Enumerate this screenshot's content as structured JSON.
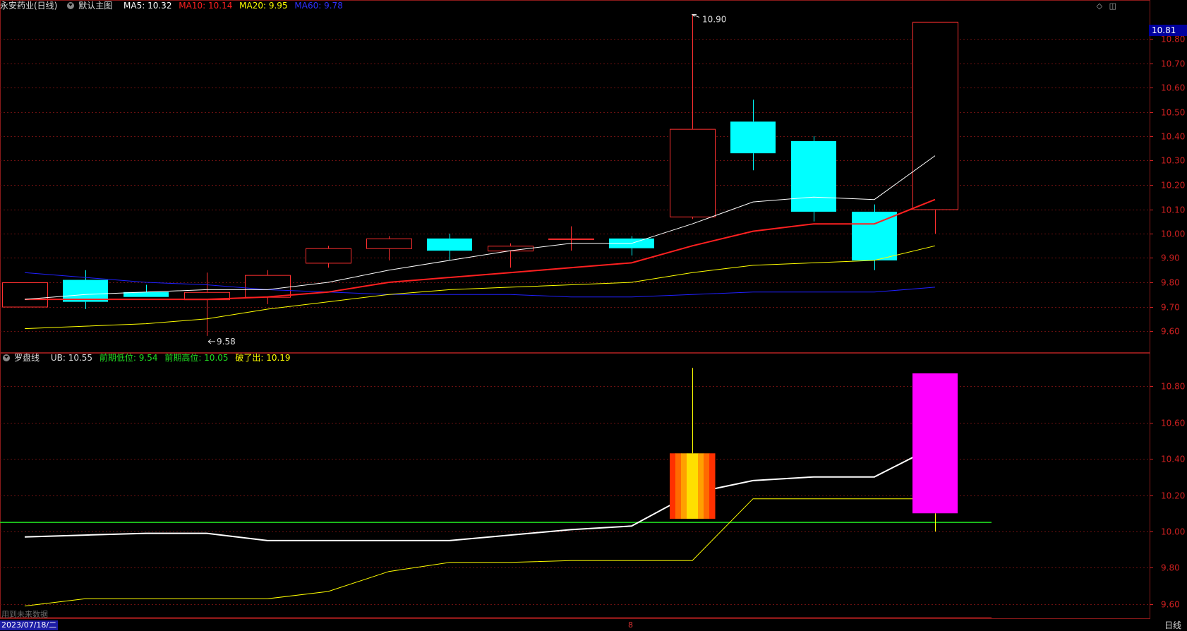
{
  "main_legend": {
    "title": "永安药业(日线)",
    "template": "默认主图",
    "ma5": "MA5: 10.32",
    "ma10": "MA10: 10.14",
    "ma20": "MA20: 9.95",
    "ma60": "MA60: 9.78",
    "colors": {
      "ma5": "#ffffff",
      "ma10": "#ff2020",
      "ma20": "#ffff00",
      "ma60": "#2020ff"
    }
  },
  "sub_legend": {
    "title": "罗盘线",
    "ub": "UB: 10.55",
    "prev_low": "前期低位: 9.54",
    "prev_high": "前期高位: 10.05",
    "break_out": "破了出: 10.19"
  },
  "last_price_tag": "10.81",
  "top_icons": [
    "diamond-icon",
    "panel-icon"
  ],
  "bottom": {
    "date": "2023/07/18/二",
    "month_marker": "8",
    "period": "日线",
    "future_note": "用到未来数据"
  },
  "chart_data": [
    {
      "type": "candlestick",
      "panel": "main",
      "ylim": [
        9.52,
        10.96
      ],
      "yticks": [
        9.6,
        9.7,
        9.8,
        9.9,
        10.0,
        10.1,
        10.2,
        10.3,
        10.4,
        10.5,
        10.6,
        10.7,
        10.8
      ],
      "ytick_labels": [
        "9.60",
        "9.70",
        "9.80",
        "9.90",
        "10.00",
        "10.10",
        "10.20",
        "10.30",
        "10.40",
        "10.50",
        "10.60",
        "10.70",
        "10.80"
      ],
      "candles": [
        {
          "o": 9.7,
          "h": 9.8,
          "l": 9.7,
          "c": 9.8
        },
        {
          "o": 9.81,
          "h": 9.85,
          "l": 9.69,
          "c": 9.72
        },
        {
          "o": 9.76,
          "h": 9.79,
          "l": 9.74,
          "c": 9.74
        },
        {
          "o": 9.73,
          "h": 9.84,
          "l": 9.58,
          "c": 9.76
        },
        {
          "o": 9.74,
          "h": 9.85,
          "l": 9.71,
          "c": 9.83
        },
        {
          "o": 9.88,
          "h": 9.95,
          "l": 9.86,
          "c": 9.94
        },
        {
          "o": 9.94,
          "h": 9.99,
          "l": 9.89,
          "c": 9.98
        },
        {
          "o": 9.98,
          "h": 10.0,
          "l": 9.89,
          "c": 9.93
        },
        {
          "o": 9.93,
          "h": 9.96,
          "l": 9.86,
          "c": 9.95
        },
        {
          "o": 9.98,
          "h": 10.03,
          "l": 9.93,
          "c": 9.98
        },
        {
          "o": 9.98,
          "h": 9.99,
          "l": 9.91,
          "c": 9.94
        },
        {
          "o": 10.07,
          "h": 10.9,
          "l": 10.06,
          "c": 10.43
        },
        {
          "o": 10.46,
          "h": 10.55,
          "l": 10.26,
          "c": 10.33
        },
        {
          "o": 10.38,
          "h": 10.4,
          "l": 10.05,
          "c": 10.09
        },
        {
          "o": 10.09,
          "h": 10.12,
          "l": 9.85,
          "c": 9.89
        },
        {
          "o": 10.1,
          "h": 10.87,
          "l": 10.0,
          "c": 10.87
        }
      ],
      "ma5": [
        9.73,
        9.75,
        9.76,
        9.77,
        9.77,
        9.8,
        9.85,
        9.89,
        9.93,
        9.96,
        9.96,
        10.04,
        10.13,
        10.15,
        10.14,
        10.32
      ],
      "ma10": [
        9.73,
        9.73,
        9.73,
        9.73,
        9.74,
        9.76,
        9.8,
        9.82,
        9.84,
        9.86,
        9.88,
        9.95,
        10.01,
        10.04,
        10.04,
        10.14
      ],
      "ma20": [
        9.61,
        9.62,
        9.63,
        9.65,
        9.69,
        9.72,
        9.75,
        9.77,
        9.78,
        9.79,
        9.8,
        9.84,
        9.87,
        9.88,
        9.89,
        9.95
      ],
      "ma60": [
        9.84,
        9.82,
        9.8,
        9.79,
        9.77,
        9.76,
        9.75,
        9.75,
        9.75,
        9.74,
        9.74,
        9.75,
        9.76,
        9.76,
        9.76,
        9.78
      ],
      "annotations": [
        {
          "label": "10.90",
          "candle": 11,
          "value": 10.9
        },
        {
          "label": "9.58",
          "candle": 3,
          "value": 9.58
        }
      ]
    },
    {
      "type": "line",
      "panel": "sub",
      "ylim": [
        9.52,
        10.96
      ],
      "yticks": [
        9.6,
        9.8,
        10.0,
        10.2,
        10.4,
        10.6,
        10.8
      ],
      "ytick_labels": [
        "9.60",
        "9.80",
        "10.00",
        "10.20",
        "10.40",
        "10.60",
        "10.80"
      ],
      "white_line": [
        9.97,
        9.98,
        9.99,
        9.99,
        9.95,
        9.95,
        9.95,
        9.95,
        9.98,
        10.01,
        10.03,
        10.21,
        10.28,
        10.3,
        10.3,
        10.47
      ],
      "yellow_line": [
        9.59,
        9.63,
        9.63,
        9.63,
        9.63,
        9.67,
        9.78,
        9.83,
        9.83,
        9.84,
        9.84,
        9.84,
        10.18,
        10.18,
        10.18,
        10.18
      ],
      "green_level": 10.05,
      "signal_bars": [
        {
          "candle": 11,
          "open": 10.07,
          "close": 10.43,
          "high": 10.9,
          "color": "flame"
        },
        {
          "candle": 15,
          "open": 10.1,
          "close": 10.87,
          "low": 10.0,
          "color": "#ff00ff"
        }
      ]
    }
  ]
}
